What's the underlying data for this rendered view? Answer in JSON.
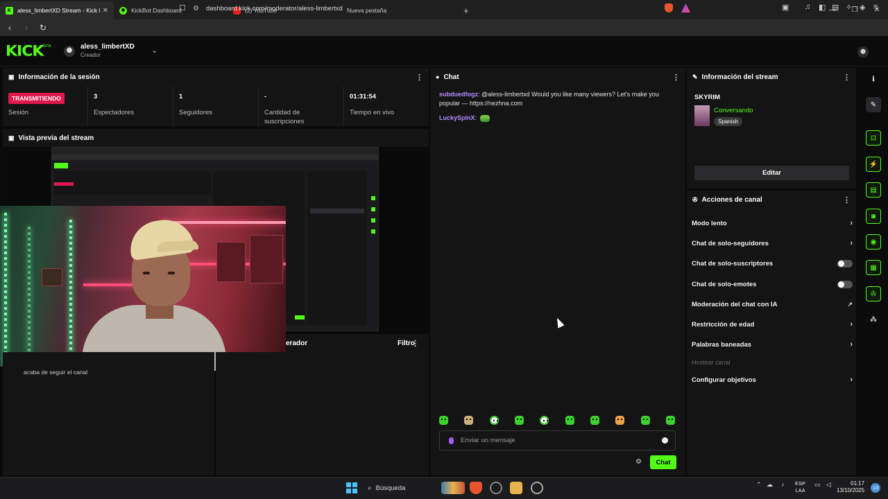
{
  "browser": {
    "tabs": [
      {
        "label": "aless_limbertXD Stream - Kick D",
        "icon": "kick-icon",
        "active": true
      },
      {
        "label": "KickBot Dashboard",
        "icon": "kickbot-icon",
        "active": false
      },
      {
        "label": "(2) YouTube",
        "icon": "youtube-icon",
        "active": false
      },
      {
        "label": "Nueva pestaña",
        "icon": "",
        "active": false
      }
    ],
    "url": "dashboard.kick.com/moderator/aless-limbertxd"
  },
  "header": {
    "logo": "KICK",
    "beta": "BETA",
    "username": "aless_limbertXD",
    "role": "Creador"
  },
  "session": {
    "title": "Información de la sesión",
    "stats": [
      {
        "value_badge": "TRANSMITIENDO",
        "label": "Sesión"
      },
      {
        "value": "3",
        "label": "Espectadores"
      },
      {
        "value": "1",
        "label": "Seguidores"
      },
      {
        "value": "-",
        "label": "Cantidad de suscripciones"
      },
      {
        "value": "01:31:54",
        "label": "Tiempo en vivo"
      }
    ]
  },
  "preview": {
    "title": "Vista previa del stream"
  },
  "moderation": {
    "title_partial": "erador",
    "filter": "Filtro"
  },
  "activity": {
    "event": "acaba de seguir el canal"
  },
  "chat": {
    "title": "Chat",
    "messages": [
      {
        "user": "subduedfogz",
        "text": " @aless-limbertxd Would you like many viewers? Let's make you popular — https://nezhna.com",
        "color": "#b58cff"
      },
      {
        "user": "LuckySpinX",
        "text": "",
        "color": "#b58cff"
      }
    ],
    "input_placeholder": "Enviar un mensaje",
    "send_label": "Chat"
  },
  "stream_info": {
    "title": "Información del stream",
    "stream_title": "SKYRIM",
    "category": "Conversando",
    "language": "Spanish",
    "edit_label": "Editar"
  },
  "channel_actions": {
    "title": "Acciones de canal",
    "items": [
      {
        "label": "Modo lento",
        "control": "chevron"
      },
      {
        "label": "Chat de solo-seguidores",
        "control": "chevron"
      },
      {
        "label": "Chat de solo-suscriptores",
        "control": "toggle"
      },
      {
        "label": "Chat de solo-emotes",
        "control": "toggle"
      },
      {
        "label": "Moderación del chat con IA",
        "control": "external"
      },
      {
        "label": "Restricción de edad",
        "control": "chevron"
      },
      {
        "label": "Palabras baneadas",
        "control": "chevron"
      },
      {
        "label": "Hostear canal",
        "control": "disabled"
      },
      {
        "label": "Configurar objetivos",
        "control": "chevron"
      }
    ]
  },
  "taskbar": {
    "search": "Búsqueda",
    "lang_top": "ESP",
    "lang_bottom": "LAA",
    "time": "01:17",
    "date": "13/10/2025",
    "notifications": "13"
  },
  "colors": {
    "accent": "#53fc18",
    "live": "#e0184d",
    "username": "#b58cff"
  }
}
